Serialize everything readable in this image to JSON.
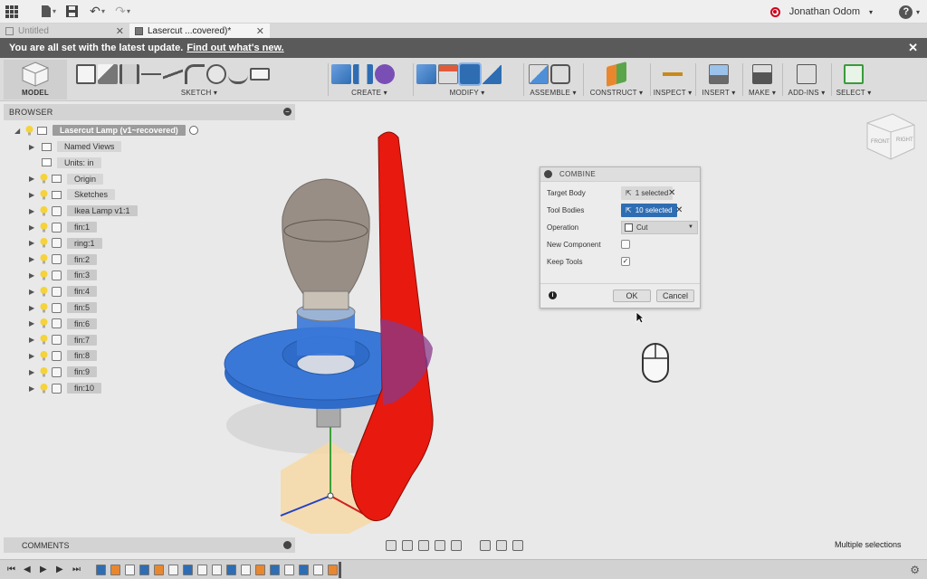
{
  "topbar": {
    "user_name": "Jonathan Odom",
    "help_label": "?"
  },
  "tabs": [
    {
      "label": "Untitled",
      "active": false
    },
    {
      "label": "Lasercut ...covered)*",
      "active": true
    }
  ],
  "banner": {
    "text": "You are all set with the latest update.",
    "link": "Find out what's new."
  },
  "toolbar": {
    "groups": [
      "MODEL",
      "SKETCH",
      "CREATE",
      "MODIFY",
      "ASSEMBLE",
      "CONSTRUCT",
      "INSPECT",
      "INSERT",
      "MAKE",
      "ADD-INS",
      "SELECT"
    ]
  },
  "browser": {
    "title": "BROWSER",
    "root": "Lasercut Lamp (v1~recovered)",
    "items": [
      {
        "label": "Named Views",
        "type": "folder"
      },
      {
        "label": "Units: in",
        "type": "units"
      },
      {
        "label": "Origin",
        "type": "folder"
      },
      {
        "label": "Sketches",
        "type": "folder"
      },
      {
        "label": "Ikea Lamp v1:1",
        "type": "component"
      },
      {
        "label": "fin:1",
        "type": "body"
      },
      {
        "label": "ring:1",
        "type": "body"
      },
      {
        "label": "fin:2",
        "type": "body"
      },
      {
        "label": "fin:3",
        "type": "body"
      },
      {
        "label": "fin:4",
        "type": "body"
      },
      {
        "label": "fin:5",
        "type": "body"
      },
      {
        "label": "fin:6",
        "type": "body"
      },
      {
        "label": "fin:7",
        "type": "body"
      },
      {
        "label": "fin:8",
        "type": "body"
      },
      {
        "label": "fin:9",
        "type": "body"
      },
      {
        "label": "fin:10",
        "type": "body"
      }
    ]
  },
  "comments": {
    "title": "COMMENTS"
  },
  "dialog": {
    "title": "COMBINE",
    "target_body_label": "Target Body",
    "target_body_value": "1 selected",
    "tool_bodies_label": "Tool Bodies",
    "tool_bodies_value": "10 selected",
    "operation_label": "Operation",
    "operation_value": "Cut",
    "new_component_label": "New Component",
    "new_component_checked": false,
    "keep_tools_label": "Keep Tools",
    "keep_tools_checked": true,
    "ok_label": "OK",
    "cancel_label": "Cancel"
  },
  "viewcube": {
    "front": "FRONT",
    "right": "RIGHT"
  },
  "status": {
    "text": "Multiple selections"
  },
  "colors": {
    "accent_blue": "#2f6db3",
    "selection_red": "#e8190f",
    "ring_blue": "#3a78d8"
  }
}
